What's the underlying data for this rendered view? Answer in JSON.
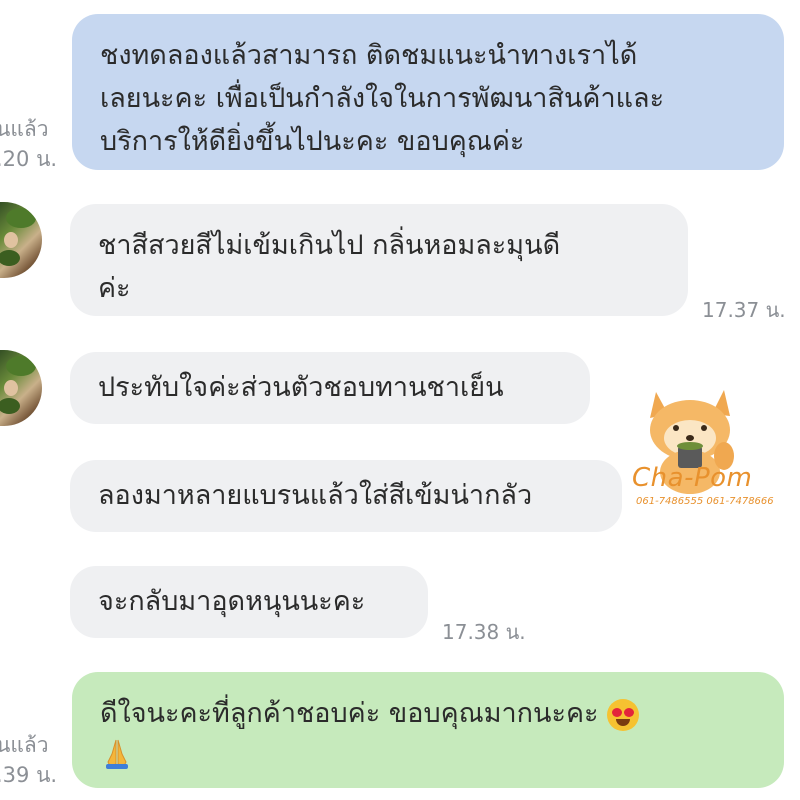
{
  "messages": [
    {
      "id": "m1",
      "side": "sent",
      "lines": [
        "ชงทดลองแล้วสามารถ ติดชมแนะนำทางเราได้",
        "เลยนะคะ เพื่อเป็นกำลังใจในการพัฒนาสินค้าและ",
        "บริการให้ดียิ่งขึ้นไปนะคะ ขอบคุณค่ะ"
      ],
      "read_label": "นแล้ว",
      "time": ".20 น."
    },
    {
      "id": "m2",
      "side": "received",
      "lines": [
        "ชาสีสวยสีไม่เข้มเกินไป กลิ่นหอมละมุนดี",
        "ค่ะ"
      ],
      "time": "17.37 น."
    },
    {
      "id": "m3",
      "side": "received",
      "lines": [
        "ประทับใจค่ะส่วนตัวชอบทานชาเย็น"
      ]
    },
    {
      "id": "m4",
      "side": "received",
      "lines": [
        "ลองมาหลายแบรนแล้วใส่สีเข้มน่ากลัว"
      ]
    },
    {
      "id": "m5",
      "side": "received",
      "lines": [
        "จะกลับมาอุดหนุนนะคะ"
      ],
      "time": "17.38 น."
    },
    {
      "id": "m6",
      "side": "sent",
      "lines": [
        "ดีใจนะคะที่ลูกค้าชอบค่ะ ขอบคุณมากนะคะ"
      ],
      "read_label": "นแล้ว",
      "time": ".39 น.",
      "emoji": [
        "heart-eyes",
        "folded-hands"
      ]
    }
  ],
  "watermark": {
    "brand": "Cha-Pom",
    "phones": "061-7486555  061-7478666"
  },
  "colors": {
    "sent_bubble_blue": "#c6d7f0",
    "sent_bubble_green": "#c6eabc",
    "received_bubble": "#eff0f2",
    "meta_text": "#8b8f95",
    "watermark": "#e8912d"
  }
}
